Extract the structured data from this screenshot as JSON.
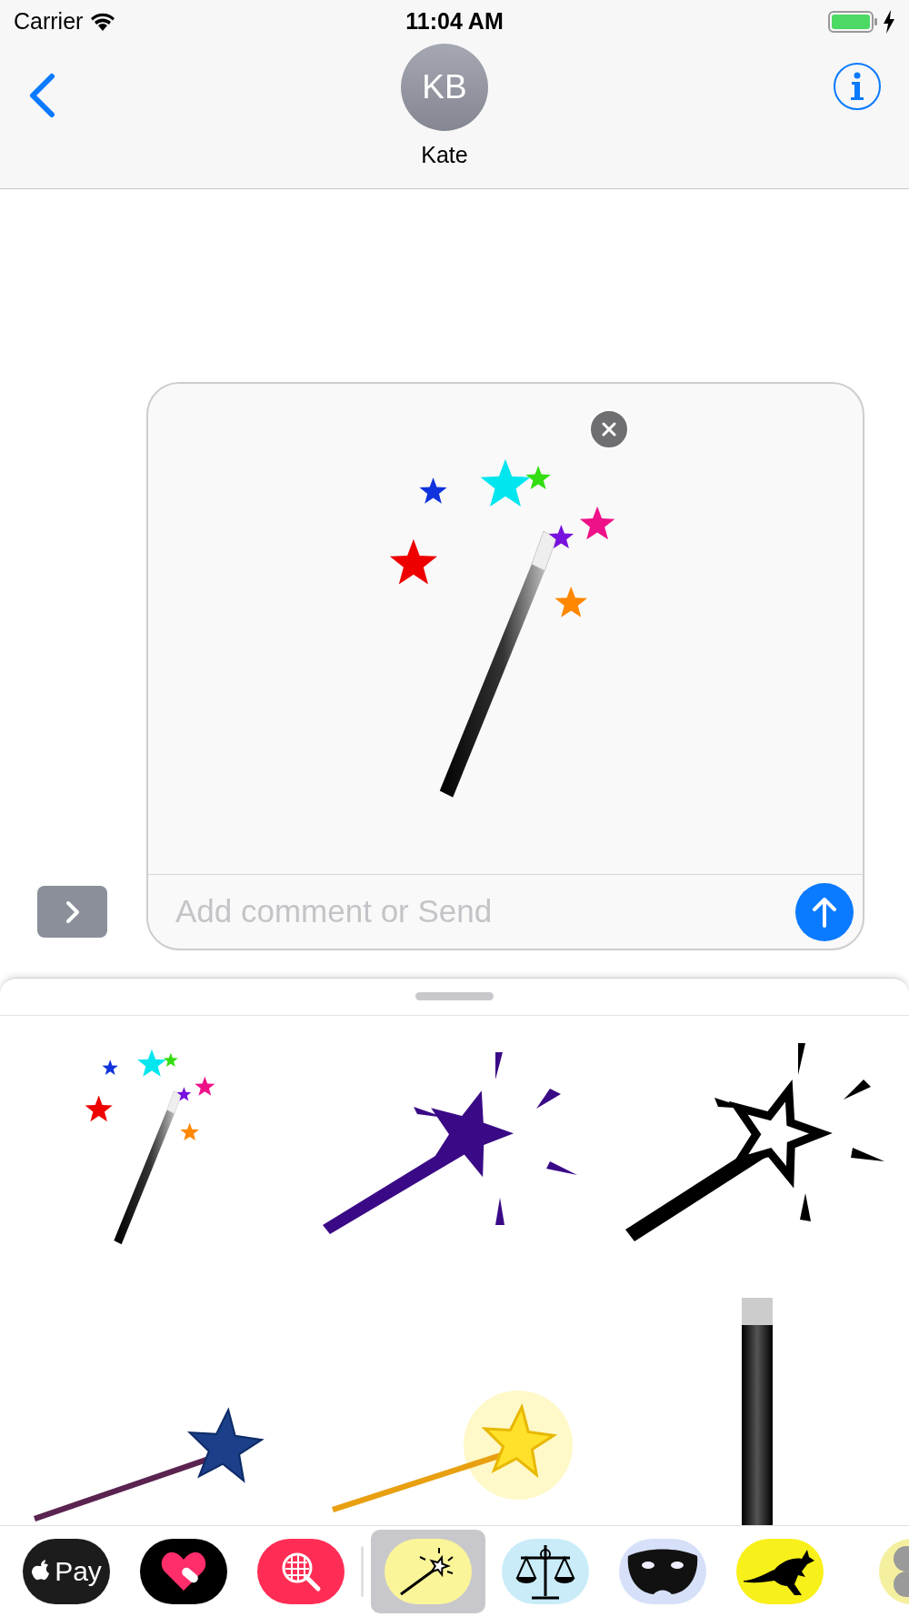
{
  "status_bar": {
    "carrier": "Carrier",
    "time": "11:04 AM",
    "battery": {
      "level": 1
    }
  },
  "header": {
    "initials": "KB",
    "name": "Kate"
  },
  "compose": {
    "placeholder": "Add comment or Send"
  },
  "stickers": [
    {
      "kind": "sparkle-wand"
    },
    {
      "kind": "purple-wand"
    },
    {
      "kind": "outline-wand"
    },
    {
      "kind": "blue-star-wand"
    },
    {
      "kind": "gold-wand"
    },
    {
      "kind": "black-wand"
    }
  ],
  "app_strip": [
    {
      "kind": "pay",
      "label": "Pay",
      "selected": false
    },
    {
      "kind": "heart",
      "selected": false
    },
    {
      "kind": "search",
      "selected": false
    },
    {
      "kind": "wand",
      "selected": true
    },
    {
      "kind": "scales",
      "selected": false
    },
    {
      "kind": "mask",
      "selected": false
    },
    {
      "kind": "kangaroo",
      "selected": false
    },
    {
      "kind": "koala",
      "selected": false
    }
  ]
}
